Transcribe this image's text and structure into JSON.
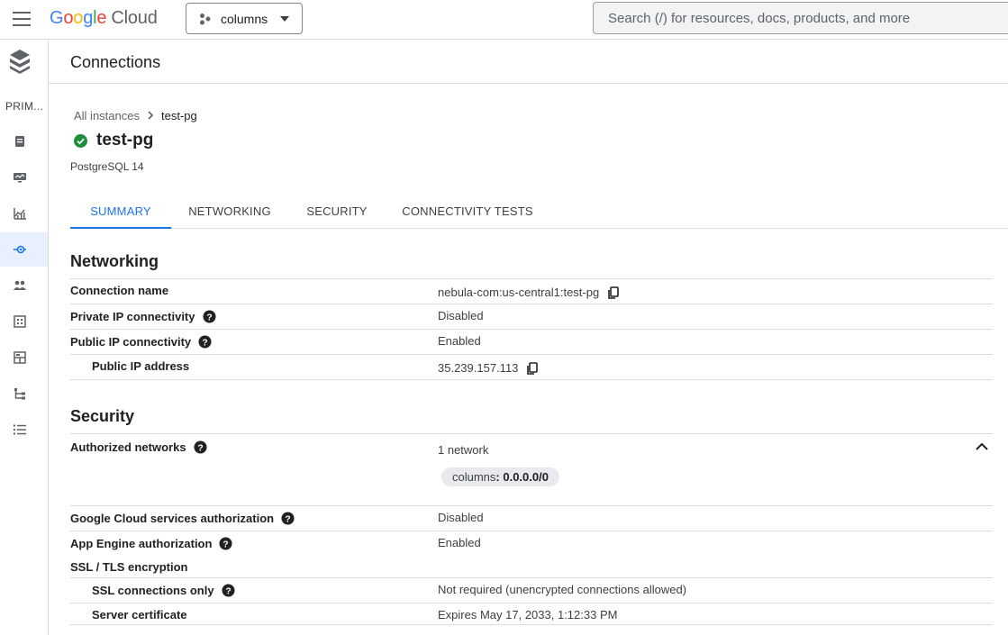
{
  "topbar": {
    "brand": {
      "letters": [
        "G",
        "o",
        "o",
        "g",
        "l",
        "e"
      ],
      "product": "Cloud"
    },
    "project": "columns",
    "search_placeholder": "Search (/) for resources, docs, products, and more"
  },
  "rail": {
    "label": "PRIM...",
    "items": [
      {
        "icon": "instance-icon"
      },
      {
        "icon": "monitoring-icon"
      },
      {
        "icon": "insights-icon"
      },
      {
        "icon": "connections-icon",
        "active": true
      },
      {
        "icon": "users-icon"
      },
      {
        "icon": "databases-icon"
      },
      {
        "icon": "backups-icon"
      },
      {
        "icon": "replicas-icon"
      },
      {
        "icon": "operations-icon"
      }
    ]
  },
  "header": {
    "title": "Connections"
  },
  "breadcrumb": {
    "parent": "All instances",
    "current": "test-pg"
  },
  "instance": {
    "name": "test-pg",
    "version": "PostgreSQL 14"
  },
  "tabs": [
    "SUMMARY",
    "NETWORKING",
    "SECURITY",
    "CONNECTIVITY TESTS"
  ],
  "networking": {
    "title": "Networking",
    "connection_name_label": "Connection name",
    "connection_name": "nebula-com:us-central1:test-pg",
    "private_ip_label": "Private IP connectivity",
    "private_ip": "Disabled",
    "public_ip_label": "Public IP connectivity",
    "public_ip": "Enabled",
    "public_ip_address_label": "Public IP address",
    "public_ip_address": "35.239.157.113"
  },
  "security": {
    "title": "Security",
    "authorized_networks_label": "Authorized networks",
    "authorized_networks": "1 network",
    "network_chip_name": "columns",
    "network_chip_range": ": 0.0.0.0/0",
    "gcs_auth_label": "Google Cloud services authorization",
    "gcs_auth": "Disabled",
    "app_engine_label": "App Engine authorization",
    "app_engine": "Enabled",
    "ssl_label": "SSL / TLS encryption",
    "ssl_only_label": "SSL connections only",
    "ssl_only": "Not required (unencrypted connections allowed)",
    "server_cert_label": "Server certificate",
    "server_cert": "Expires May 17, 2033, 1:12:33 PM"
  },
  "colors": {
    "accent": "#1a73e8",
    "success": "#1e8e3e",
    "active_bg": "#e8f0fe"
  }
}
